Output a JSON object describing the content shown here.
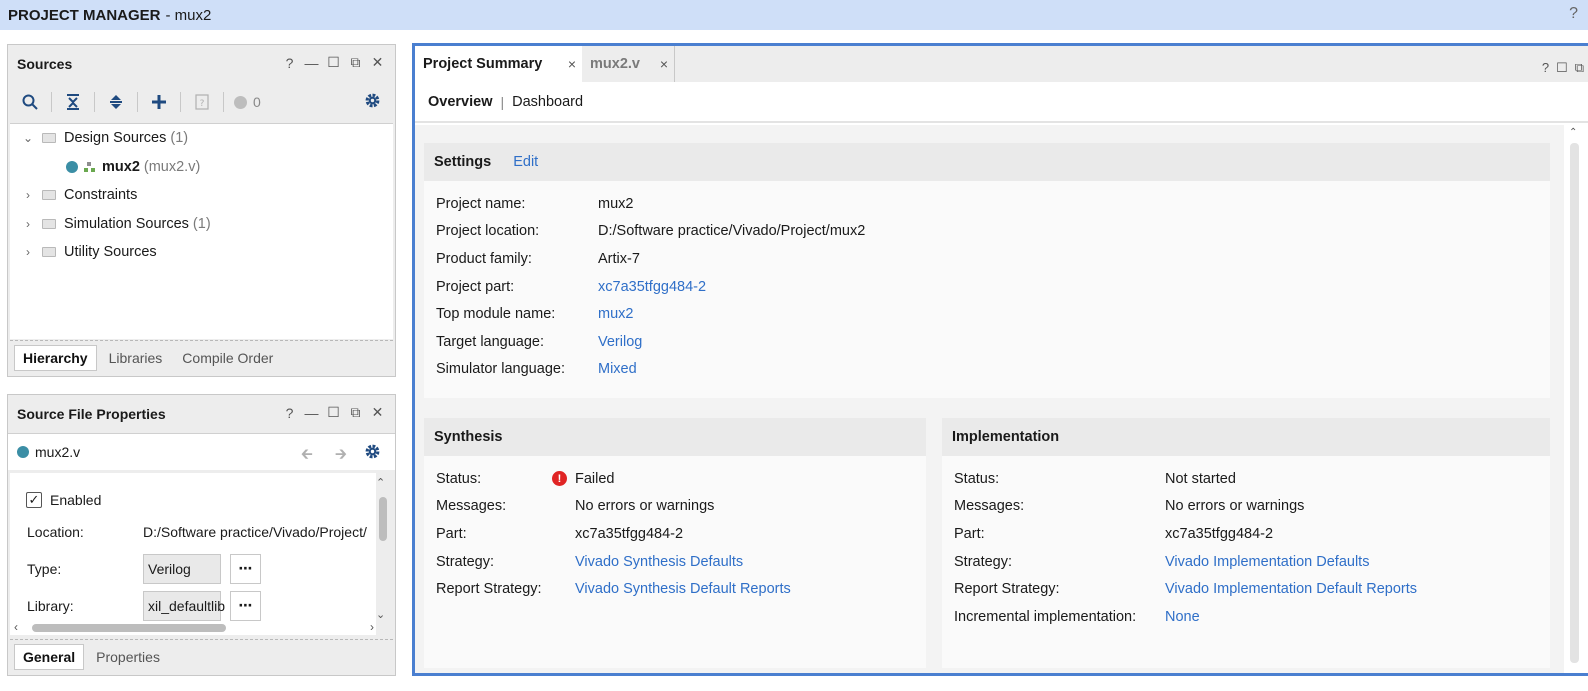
{
  "topbar": {
    "title": "PROJECT MANAGER",
    "project": "- mux2",
    "help": "?"
  },
  "sources": {
    "title": "Sources",
    "controls": [
      "?",
      "—",
      "☐",
      "⧉",
      "✕"
    ],
    "count": "0",
    "tree": {
      "design_sources": {
        "label": "Design Sources",
        "count": "(1)"
      },
      "module": {
        "name": "mux2",
        "file": "(mux2.v)"
      },
      "constraints": {
        "label": "Constraints"
      },
      "simulation_sources": {
        "label": "Simulation Sources",
        "count": "(1)"
      },
      "utility_sources": {
        "label": "Utility Sources"
      }
    },
    "tabs": [
      "Hierarchy",
      "Libraries",
      "Compile Order"
    ]
  },
  "props": {
    "title": "Source File Properties",
    "controls": [
      "?",
      "—",
      "☐",
      "⧉",
      "✕"
    ],
    "file": "mux2.v",
    "enabled_label": "Enabled",
    "location_label": "Location:",
    "location_value": "D:/Software practice/Vivado/Project/",
    "type_label": "Type:",
    "type_value": "Verilog",
    "library_label": "Library:",
    "library_value": "xil_defaultlib",
    "dots": "⋯",
    "tabs": [
      "General",
      "Properties"
    ]
  },
  "main": {
    "tabs": [
      {
        "label": "Project Summary",
        "close": "×"
      },
      {
        "label": "mux2.v",
        "close": "×"
      }
    ],
    "tab_controls": [
      "?",
      "☐",
      "⧉"
    ],
    "subnav": {
      "overview": "Overview",
      "sep": "|",
      "dashboard": "Dashboard"
    },
    "settings": {
      "title": "Settings",
      "edit": "Edit",
      "rows": [
        {
          "k": "Project name:",
          "v": "mux2"
        },
        {
          "k": "Project location:",
          "v": "D:/Software practice/Vivado/Project/mux2"
        },
        {
          "k": "Product family:",
          "v": "Artix-7"
        },
        {
          "k": "Project part:",
          "v": "xc7a35tfgg484-2"
        },
        {
          "k": "Top module name:",
          "v": "mux2"
        },
        {
          "k": "Target language:",
          "v": "Verilog"
        },
        {
          "k": "Simulator language:",
          "v": "Mixed"
        }
      ]
    },
    "synthesis": {
      "title": "Synthesis",
      "error_icon": "!",
      "rows": [
        {
          "k": "Status:",
          "v": "Failed"
        },
        {
          "k": "Messages:",
          "v": "No errors or warnings"
        },
        {
          "k": "Part:",
          "v": "xc7a35tfgg484-2"
        },
        {
          "k": "Strategy:",
          "v": "Vivado Synthesis Defaults"
        },
        {
          "k": "Report Strategy:",
          "v": "Vivado Synthesis Default Reports"
        }
      ]
    },
    "implementation": {
      "title": "Implementation",
      "rows": [
        {
          "k": "Status:",
          "v": "Not started"
        },
        {
          "k": "Messages:",
          "v": "No errors or warnings"
        },
        {
          "k": "Part:",
          "v": "xc7a35tfgg484-2"
        },
        {
          "k": "Strategy:",
          "v": "Vivado Implementation Defaults"
        },
        {
          "k": "Report Strategy:",
          "v": "Vivado Implementation Default Reports"
        },
        {
          "k": "Incremental implementation:",
          "v": "None"
        }
      ]
    }
  },
  "colors": {
    "accent": "#4a7fd0",
    "link": "#2f6fc8",
    "topbar": "#cfdff8",
    "error": "#e02424",
    "file_dot": "#3b8ea5"
  }
}
